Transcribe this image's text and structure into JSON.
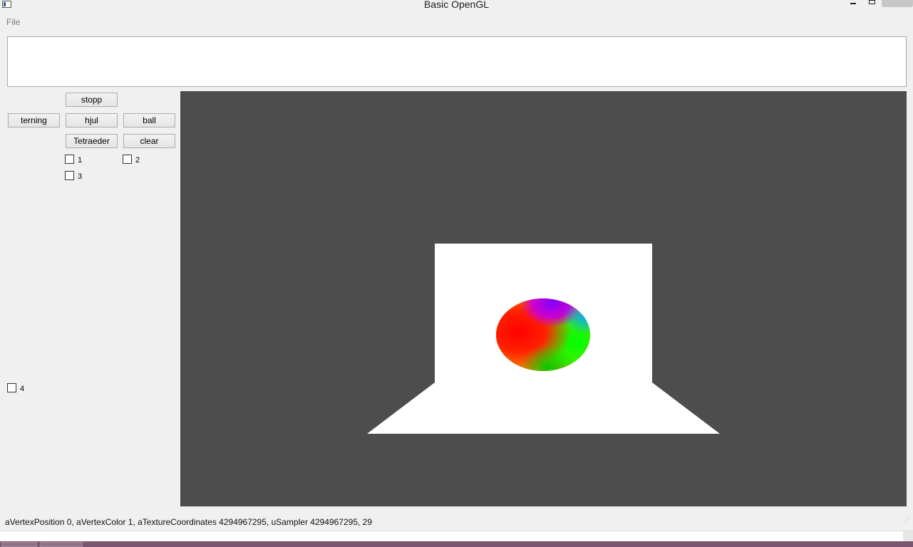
{
  "window": {
    "title": "Basic OpenGL"
  },
  "menu": {
    "file": "File"
  },
  "controls": {
    "stopp": "stopp",
    "terning": "terning",
    "hjul": "hjul",
    "ball": "ball",
    "tetraeder": "Tetraeder",
    "clear": "clear",
    "checkboxes": [
      {
        "label": "1",
        "checked": false
      },
      {
        "label": "2",
        "checked": false
      },
      {
        "label": "3",
        "checked": false
      },
      {
        "label": "4",
        "checked": false
      }
    ]
  },
  "scene": {
    "background_color": "#4d4d4d",
    "plane_color": "#ffffff",
    "sphere_colors": [
      "#ff0000",
      "#ff7f00",
      "#00ff00",
      "#8000ff",
      "#00aaff"
    ]
  },
  "status": {
    "text": "aVertexPosition 0, aVertexColor 1, aTextureCoordinates 4294967295, uSampler 4294967295, 29"
  }
}
